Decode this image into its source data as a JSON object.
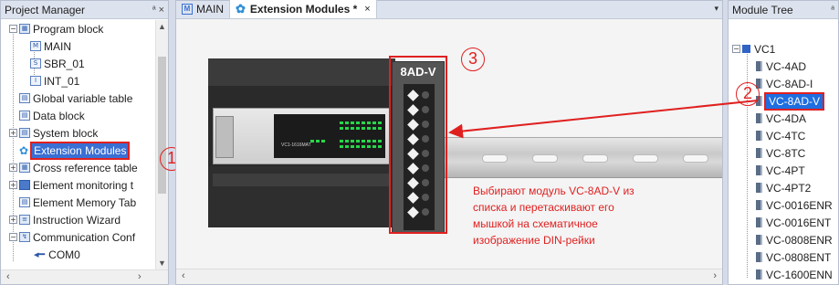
{
  "project_manager": {
    "title": "Project Manager",
    "pin": "ᵃ",
    "close": "×",
    "items": [
      {
        "label": "Program block",
        "icon": "program-block-icon"
      },
      {
        "label": "MAIN",
        "icon": "main-program-icon"
      },
      {
        "label": "SBR_01",
        "icon": "subroutine-icon"
      },
      {
        "label": "INT_01",
        "icon": "interrupt-icon"
      },
      {
        "label": "Global variable table",
        "icon": "variable-table-icon"
      },
      {
        "label": "Data block",
        "icon": "data-block-icon"
      },
      {
        "label": "System block",
        "icon": "system-block-icon"
      },
      {
        "label": "Extension Modules",
        "icon": "gear-icon"
      },
      {
        "label": "Cross reference table",
        "icon": "cross-reference-icon"
      },
      {
        "label": "Element monitoring t",
        "icon": "monitoring-icon"
      },
      {
        "label": "Element Memory Tab",
        "icon": "memory-table-icon"
      },
      {
        "label": "Instruction Wizard",
        "icon": "wizard-icon"
      },
      {
        "label": "Communication Conf",
        "icon": "communication-icon"
      },
      {
        "label": "COM0",
        "icon": "port-icon"
      }
    ],
    "marker": "1"
  },
  "center": {
    "tabs": [
      {
        "label": "MAIN",
        "icon": "M"
      },
      {
        "label": "Extension Modules *",
        "icon": "gear-icon",
        "close": "×"
      }
    ],
    "dropdown": "▾",
    "device": {
      "main_model": "VC1-1616MAT",
      "module_label": "8AD-V"
    },
    "marker": "3",
    "note_lines": [
      "Выбирают модуль VC-8AD-V из",
      "списка и перетаскивают его",
      "мышкой на схематичное",
      "изображение DIN-рейки"
    ]
  },
  "module_tree": {
    "title": "Module Tree",
    "pin": "ᵃ",
    "root": "VC1",
    "items": [
      "VC-4AD",
      "VC-8AD-I",
      "VC-8AD-V",
      "VC-4DA",
      "VC-4TC",
      "VC-8TC",
      "VC-4PT",
      "VC-4PT2",
      "VC-0016ENR",
      "VC-0016ENT",
      "VC-0808ENR",
      "VC-0808ENT",
      "VC-1600ENN"
    ],
    "selected": "VC-8AD-V",
    "marker": "2"
  },
  "colors": {
    "accent_red": "#e02020",
    "selection_blue": "#3a6fd3",
    "led_green": "#27d64a"
  }
}
